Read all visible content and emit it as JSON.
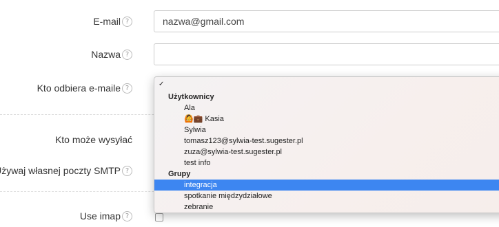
{
  "form": {
    "email": {
      "label": "E-mail",
      "value": "nazwa@gmail.com"
    },
    "name": {
      "label": "Nazwa",
      "value": ""
    },
    "recipients": {
      "label": "Kto odbiera e-maile"
    },
    "senders": {
      "label": "Kto może wysyłać"
    },
    "smtp": {
      "label": "Używaj własnej poczty SMTP"
    },
    "imap": {
      "label": "Use imap"
    },
    "help_glyph": "?"
  },
  "dropdown": {
    "check_glyph": "✓",
    "groups": [
      {
        "label": "Użytkownicy",
        "items": [
          "Ala",
          "Kasia",
          "Sylwia",
          "tomasz123@sylwia-test.sugester.pl",
          "zuza@sylwia-test.sugester.pl",
          "test info"
        ]
      },
      {
        "label": "Grupy",
        "items": [
          "integracja",
          "spotkanie międzydziałowe",
          "zebranie"
        ]
      }
    ],
    "selected": "integracja",
    "kasia_emoji": "🙆💼"
  },
  "colors": {
    "selection": "#3d86f1"
  }
}
